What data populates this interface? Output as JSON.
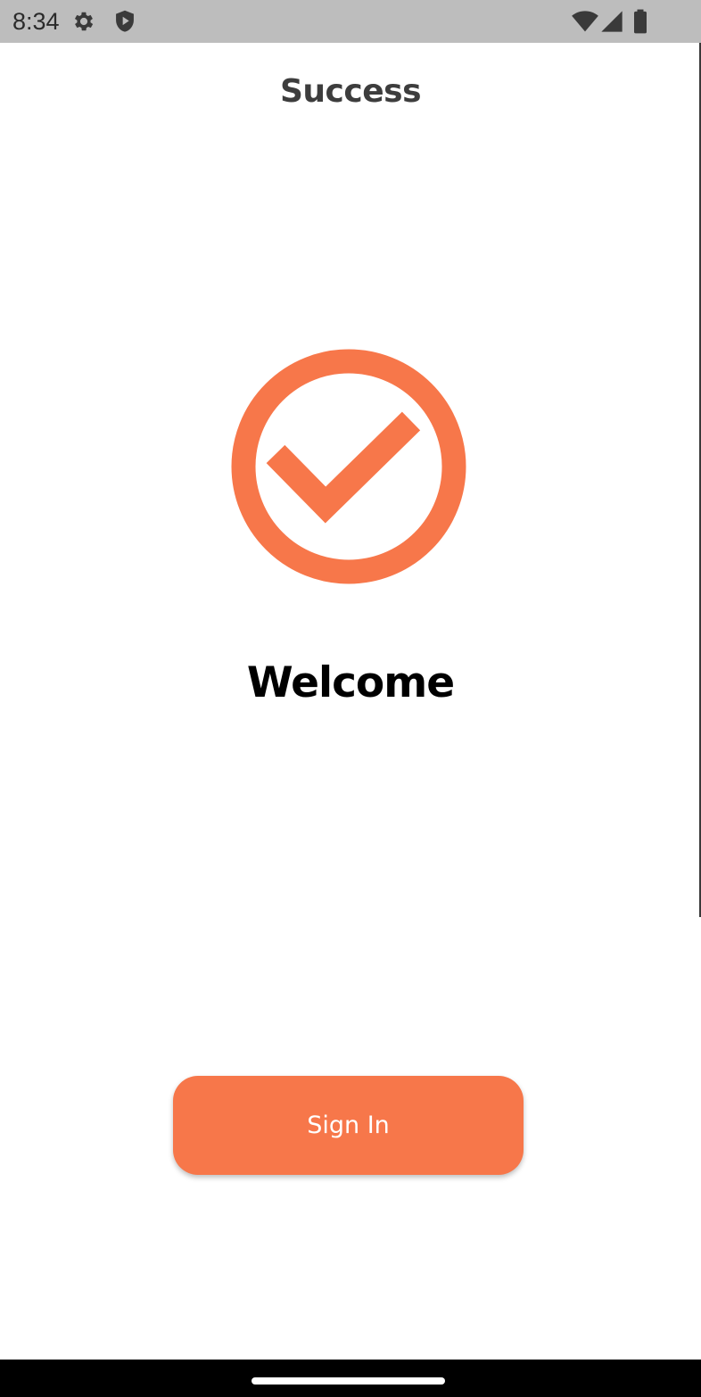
{
  "status_bar": {
    "time": "8:34",
    "left_icons": [
      "gear-icon",
      "shield-play-icon"
    ],
    "right_icons": [
      "wifi-icon",
      "cellular-signal-icon",
      "battery-icon"
    ]
  },
  "header": {
    "title": "Success"
  },
  "main": {
    "icon": "check-circle-icon",
    "heading": "Welcome",
    "sign_in_label": "Sign In"
  },
  "colors": {
    "accent": "#f7774a",
    "status_bar_bg": "#bdbdbd",
    "nav_bar_bg": "#000000"
  }
}
